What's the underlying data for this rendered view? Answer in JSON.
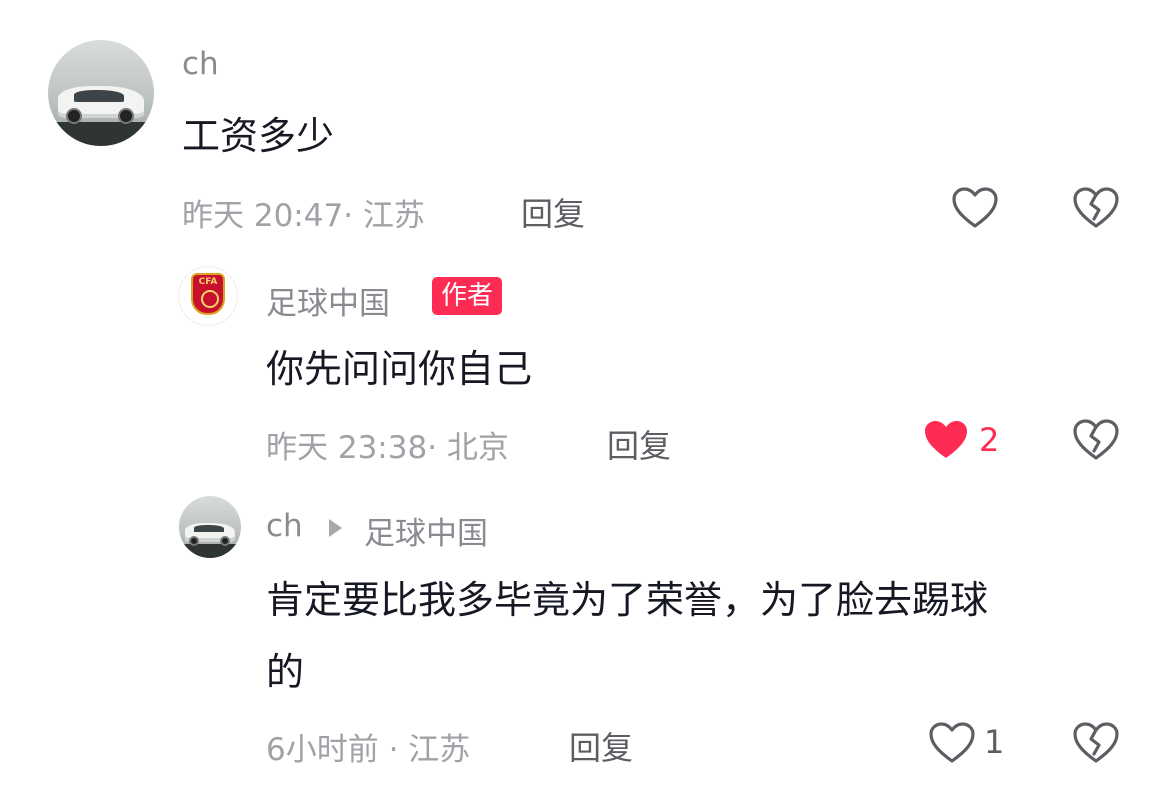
{
  "comments": [
    {
      "username": "ch",
      "text": "工资多少",
      "time_location": "昨天 20:47· 江苏",
      "reply_label": "回复",
      "like_count": "",
      "liked": false
    },
    {
      "username": "足球中国",
      "author_badge": "作者",
      "avatar_logo_text": "CFA",
      "text": "你先问问你自己",
      "time_location": "昨天 23:38· 北京",
      "reply_label": "回复",
      "like_count": "2",
      "liked": true
    },
    {
      "username": "ch",
      "reply_to": "足球中国",
      "text_line1": "肯定要比我多毕竟为了荣誉，为了脸去踢球",
      "text_line2": "的",
      "time_location": "6小时前 · 江苏",
      "reply_label": "回复",
      "like_count": "1",
      "liked": false
    }
  ],
  "colors": {
    "accent_red": "#fe2c55",
    "liked_heart": "#fe2c55",
    "meta_gray": "#a1a2a7",
    "username_gray": "#8a8b91",
    "icon_gray": "#5d5e63"
  },
  "icons": [
    "heart-outline-icon",
    "heart-filled-icon",
    "broken-heart-icon",
    "play-arrow-icon"
  ]
}
